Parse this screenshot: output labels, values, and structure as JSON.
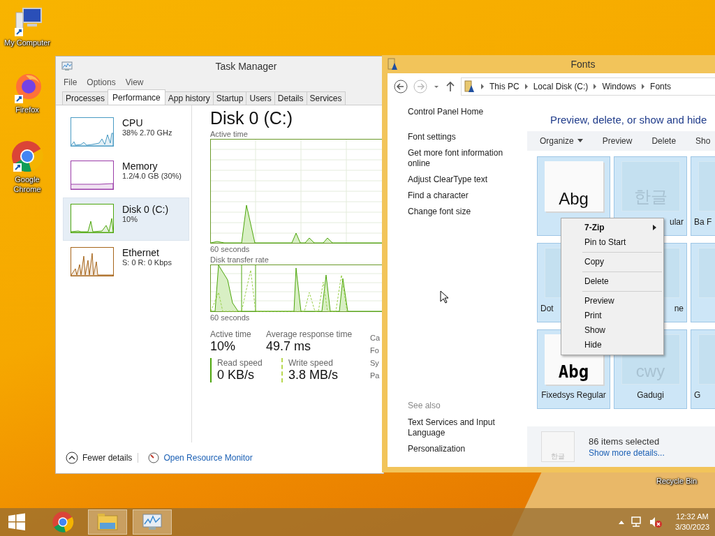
{
  "desktop_icons": [
    {
      "label": "My Computer",
      "kind": "computer"
    },
    {
      "label": "Firefox",
      "kind": "firefox"
    },
    {
      "label": "Google Chrome",
      "kind": "chrome"
    }
  ],
  "recycle_bin": {
    "label": "Recycle Bin"
  },
  "task_manager": {
    "title": "Task Manager",
    "menu": [
      "File",
      "Options",
      "View"
    ],
    "tabs": [
      {
        "label": "Processes",
        "selected": false
      },
      {
        "label": "Performance",
        "selected": true
      },
      {
        "label": "App history",
        "selected": false
      },
      {
        "label": "Startup",
        "selected": false
      },
      {
        "label": "Users",
        "selected": false
      },
      {
        "label": "Details",
        "selected": false
      },
      {
        "label": "Services",
        "selected": false
      }
    ],
    "resources": [
      {
        "name": "CPU",
        "detail": "38%  2.70 GHz",
        "color": "#4a9bc4",
        "selected": false
      },
      {
        "name": "Memory",
        "detail": "1.2/4.0 GB (30%)",
        "color": "#9b3ca8",
        "selected": false
      },
      {
        "name": "Disk 0 (C:)",
        "detail": "10%",
        "color": "#4da60c",
        "selected": true
      },
      {
        "name": "Ethernet",
        "detail": "S: 0 R: 0 Kbps",
        "color": "#a7651a",
        "selected": false
      }
    ],
    "heading": "Disk 0 (C:)",
    "active_chart": {
      "label": "Active time",
      "axis": "60 seconds"
    },
    "transfer_chart": {
      "label": "Disk transfer rate",
      "axis": "60 seconds"
    },
    "stats": [
      {
        "label": "Active time",
        "value": "10%"
      },
      {
        "label": "Average response time",
        "value": "49.7 ms"
      }
    ],
    "speeds": [
      {
        "label": "Read speed",
        "value": "0 KB/s",
        "kind": "read"
      },
      {
        "label": "Write speed",
        "value": "3.8 MB/s",
        "kind": "write"
      }
    ],
    "side_labels": [
      "Ca",
      "Fo",
      "Sy",
      "Pa"
    ],
    "fewer_details": "Fewer details",
    "resource_monitor": "Open Resource Monitor"
  },
  "fonts_window": {
    "title": "Fonts",
    "breadcrumb": [
      "This PC",
      "Local Disk (C:)",
      "Windows",
      "Fonts"
    ],
    "side_links": [
      "Control Panel Home",
      "Font settings",
      "Get more font information online",
      "Adjust ClearType text",
      "Find a character",
      "Change font size"
    ],
    "see_also": {
      "title": "See also",
      "links": [
        "Text Services and Input Language",
        "Personalization"
      ]
    },
    "heading": "Preview, delete, or show and hide",
    "toolbar": [
      {
        "label": "Organize",
        "dropdown": true
      },
      {
        "label": "Preview",
        "dropdown": false
      },
      {
        "label": "Delete",
        "dropdown": false
      },
      {
        "label": "Sho",
        "dropdown": false
      }
    ],
    "tiles": [
      {
        "kind": "sample",
        "preview": "Abg",
        "selected": true
      },
      {
        "kind": "faded",
        "preview": "한글",
        "label": {
          "text": "ular",
          "covered_left": true,
          "covered_right": false
        },
        "selected": true
      },
      {
        "kind": "faded",
        "label": {
          "text": "Ba F",
          "covered_left": false,
          "covered_right": true
        },
        "selected": true
      },
      {
        "kind": "faded",
        "label": {
          "text": "Dot",
          "covered_left": false,
          "covered_right": true
        },
        "selected": true
      },
      {
        "kind": "faded",
        "label": {
          "text": "ne",
          "covered_left": true,
          "covered_right": false
        },
        "selected": true
      },
      {
        "kind": "faded",
        "selected": true
      },
      {
        "kind": "pixel",
        "preview": "Abg",
        "label": {
          "text": "Fixedsys Regular",
          "covered_left": false,
          "covered_right": false
        },
        "selected": true
      },
      {
        "kind": "faded",
        "preview": "cwy",
        "label": {
          "text": "Gadugi",
          "covered_left": false,
          "covered_right": false
        },
        "selected": true
      },
      {
        "kind": "faded",
        "label": {
          "text": "G",
          "covered_left": false,
          "covered_right": true
        },
        "selected": true
      }
    ],
    "status": {
      "preview": "한글",
      "count": "86 items selected",
      "link": "Show more details..."
    },
    "context_menu": [
      [
        {
          "label": "7-Zip",
          "bold": true,
          "submenu": true
        },
        {
          "label": "Pin to Start",
          "bold": false,
          "submenu": false
        }
      ],
      [
        {
          "label": "Copy",
          "bold": false,
          "submenu": false
        }
      ],
      [
        {
          "label": "Delete",
          "bold": false,
          "submenu": false
        }
      ],
      [
        {
          "label": "Preview",
          "bold": false,
          "submenu": false
        },
        {
          "label": "Print",
          "bold": false,
          "submenu": false
        },
        {
          "label": "Show",
          "bold": false,
          "submenu": false
        },
        {
          "label": "Hide",
          "bold": false,
          "submenu": false
        }
      ]
    ]
  },
  "taskbar": {
    "apps": [
      {
        "kind": "chrome",
        "running": false
      },
      {
        "kind": "explorer",
        "running": true
      },
      {
        "kind": "taskmgr",
        "running": true
      }
    ],
    "time": "12:32 AM",
    "date": "3/30/2023"
  }
}
